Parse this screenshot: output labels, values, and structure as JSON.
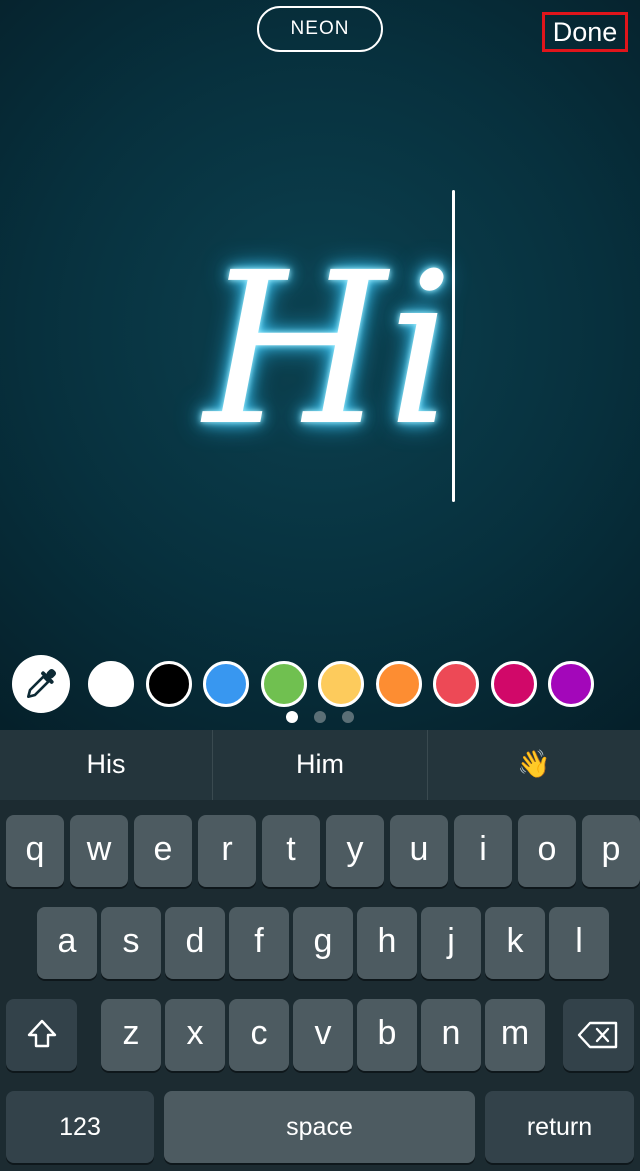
{
  "toolbar": {
    "font_style_label": "NEON",
    "done_label": "Done"
  },
  "editor": {
    "text": "Hi",
    "glow_color": "#4fd3ff"
  },
  "color_picker": {
    "eyedropper_icon": "eyedropper-icon",
    "swatches": [
      "#ffffff",
      "#000000",
      "#3897f0",
      "#70c050",
      "#fdcb5c",
      "#fd8d32",
      "#ed4956",
      "#d10869",
      "#a307ba"
    ],
    "page_count": 3,
    "current_page": 0
  },
  "suggestions": [
    "His",
    "Him",
    "👋"
  ],
  "keyboard": {
    "row1": [
      "q",
      "w",
      "e",
      "r",
      "t",
      "y",
      "u",
      "i",
      "o",
      "p"
    ],
    "row2": [
      "a",
      "s",
      "d",
      "f",
      "g",
      "h",
      "j",
      "k",
      "l"
    ],
    "row3": [
      "z",
      "x",
      "c",
      "v",
      "b",
      "n",
      "m"
    ],
    "shift_icon": "shift-icon",
    "delete_icon": "delete-icon",
    "numbers_label": "123",
    "space_label": "space",
    "return_label": "return"
  }
}
